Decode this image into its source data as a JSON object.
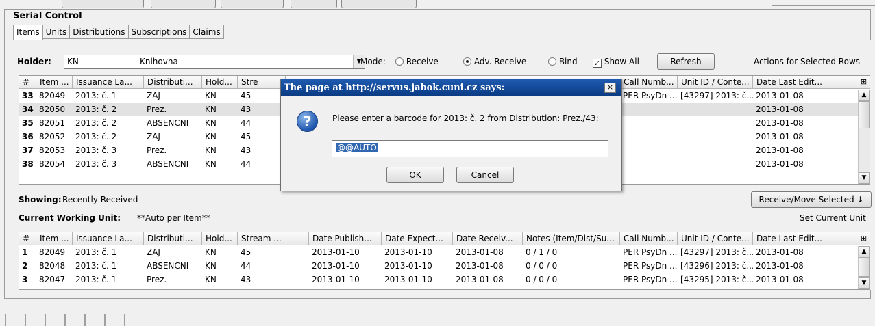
{
  "app": {
    "title": "Serial Control"
  },
  "tabs": [
    {
      "label": "Items",
      "active": true
    },
    {
      "label": "Units",
      "active": false
    },
    {
      "label": "Distributions",
      "active": false
    },
    {
      "label": "Subscriptions",
      "active": false
    },
    {
      "label": "Claims",
      "active": false
    }
  ],
  "holder": {
    "label": "Holder:",
    "code": "KN",
    "name": "Knihovna"
  },
  "mode": {
    "label": "Mode:",
    "receive": "Receive",
    "adv_receive": "Adv. Receive",
    "bind": "Bind",
    "selected": "adv_receive"
  },
  "show_all": {
    "label": "Show All",
    "checked": true
  },
  "refresh_button": "Refresh",
  "actions_label": "Actions for Selected Rows",
  "columns": [
    "#",
    "Item ...",
    "Issuance La...",
    "Distributi...",
    "Hold...",
    "Stream ...",
    "Date Publish...",
    "Date Expect...",
    "Date Receiv...",
    "Notes (Item/Dist/Su...",
    "Call Numb...",
    "Unit ID / Conte...",
    "Date Last Edit..."
  ],
  "top_rows": [
    {
      "n": "33",
      "item": "82049",
      "iss": "2013: č. 1",
      "dist": "ZAJ",
      "hold": "KN",
      "stream": "45",
      "call": "PER PsyDn ...",
      "unit": "[43297]  2013: č....",
      "edit": "2013-01-08"
    },
    {
      "n": "34",
      "item": "82050",
      "iss": "2013: č. 2",
      "dist": "Prez.",
      "hold": "KN",
      "stream": "43",
      "call": "",
      "unit": "",
      "edit": "2013-01-08"
    },
    {
      "n": "35",
      "item": "82051",
      "iss": "2013: č. 2",
      "dist": "ABSENCNI",
      "hold": "KN",
      "stream": "44",
      "call": "",
      "unit": "",
      "edit": "2013-01-08"
    },
    {
      "n": "36",
      "item": "82052",
      "iss": "2013: č. 2",
      "dist": "ZAJ",
      "hold": "KN",
      "stream": "45",
      "call": "",
      "unit": "",
      "edit": "2013-01-08"
    },
    {
      "n": "37",
      "item": "82053",
      "iss": "2013: č. 3",
      "dist": "Prez.",
      "hold": "KN",
      "stream": "43",
      "call": "",
      "unit": "",
      "edit": "2013-01-08"
    },
    {
      "n": "38",
      "item": "82054",
      "iss": "2013: č. 3",
      "dist": "ABSENCNI",
      "hold": "KN",
      "stream": "44",
      "call": "",
      "unit": "",
      "edit": "2013-01-08"
    }
  ],
  "top_stream_header": "Stre",
  "showing": {
    "label": "Showing:",
    "value": "Recently Received"
  },
  "receive_move_button": "Receive/Move Selected ↓",
  "working_unit": {
    "label": "Current Working Unit:",
    "value": "**Auto per Item**"
  },
  "set_unit_button": "Set Current Unit",
  "bottom_rows": [
    {
      "n": "1",
      "item": "82049",
      "iss": "2013: č. 1",
      "dist": "ZAJ",
      "hold": "KN",
      "stream": "45",
      "pub": "2013-01-10",
      "exp": "2013-01-10",
      "rec": "2013-01-08",
      "notes": "0 / 1 / 0",
      "call": "PER PsyDn ...",
      "unit": "[43297]  2013: č....",
      "edit": "2013-01-08"
    },
    {
      "n": "2",
      "item": "82048",
      "iss": "2013: č. 1",
      "dist": "ABSENCNI",
      "hold": "KN",
      "stream": "44",
      "pub": "2013-01-10",
      "exp": "2013-01-10",
      "rec": "2013-01-08",
      "notes": "0 / 0 / 0",
      "call": "PER PsyDn ...",
      "unit": "[43296]  2013: č....",
      "edit": "2013-01-08"
    },
    {
      "n": "3",
      "item": "82047",
      "iss": "2013: č. 1",
      "dist": "Prez.",
      "hold": "KN",
      "stream": "43",
      "pub": "2013-01-10",
      "exp": "2013-01-10",
      "rec": "2013-01-08",
      "notes": "0 / 0 / 0",
      "call": "PER PsyDn ...",
      "unit": "[43295]  2013: č....",
      "edit": "2013-01-08"
    }
  ],
  "dialog": {
    "title": "The page at http://servus.jabok.cuni.cz says:",
    "message": "Please enter a barcode for 2013: č. 2 from Distribution: Prez./43:",
    "input_value": "@@AUTO",
    "ok": "OK",
    "cancel": "Cancel"
  },
  "icons": {
    "question": "?",
    "close": "×",
    "columns_picker": "⊞"
  },
  "colors": {
    "dialog_title": "#0a3a82",
    "selection": "#3167b0"
  }
}
